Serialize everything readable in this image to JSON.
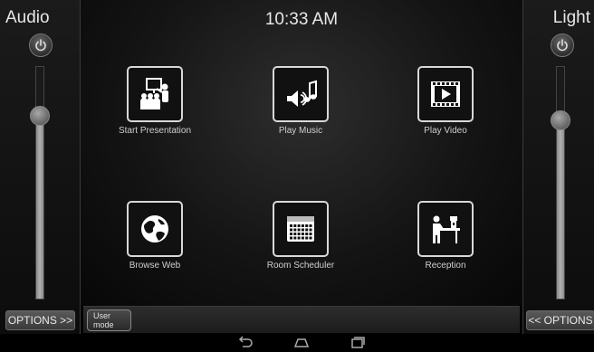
{
  "left_panel": {
    "title": "Audio",
    "level": 0.79,
    "options_label": "OPTIONS >>"
  },
  "right_panel": {
    "title": "Light",
    "level": 0.77,
    "options_label": "<< OPTIONS"
  },
  "clock": "10:33 AM",
  "tiles": [
    {
      "label": "Start Presentation",
      "icon": "presentation-icon"
    },
    {
      "label": "Play Music",
      "icon": "music-icon"
    },
    {
      "label": "Play Video",
      "icon": "video-icon"
    },
    {
      "label": "Browse Web",
      "icon": "globe-icon"
    },
    {
      "label": "Room Scheduler",
      "icon": "calendar-icon"
    },
    {
      "label": "Reception",
      "icon": "reception-icon"
    }
  ],
  "bottom_bar": {
    "user_mode_line1": "User",
    "user_mode_line2": "mode"
  },
  "nav": [
    "back-icon",
    "home-icon",
    "recent-apps-icon"
  ],
  "colors": {
    "background": "#000000",
    "slider_fill": "#a0a0a0",
    "tile_border": "#d8d8d8"
  }
}
